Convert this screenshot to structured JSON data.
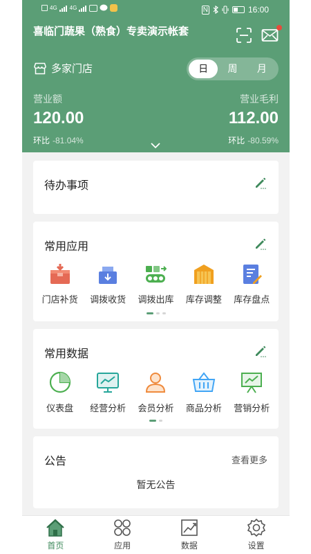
{
  "status_bar": {
    "time": "16:00",
    "left_tags": [
      "HD",
      "4G",
      "4G"
    ]
  },
  "header": {
    "store_title": "喜临门蔬果（熟食）专卖演示帐套",
    "store_selector": "多家门店",
    "periods": [
      "日",
      "周",
      "月"
    ],
    "active_period": "日",
    "metrics": [
      {
        "label": "营业额",
        "value": "120.00",
        "compare_label": "环比",
        "compare_value": "-81.04%"
      },
      {
        "label": "营业毛利",
        "value": "112.00",
        "compare_label": "环比",
        "compare_value": "-80.59%"
      }
    ]
  },
  "todo": {
    "title": "待办事项"
  },
  "common_apps": {
    "title": "常用应用",
    "items": [
      {
        "label": "门店补货",
        "icon": "restock-box-icon"
      },
      {
        "label": "调拨收货",
        "icon": "transfer-receive-icon"
      },
      {
        "label": "调拨出库",
        "icon": "transfer-out-icon"
      },
      {
        "label": "库存调整",
        "icon": "inventory-adjust-icon"
      },
      {
        "label": "库存盘点",
        "icon": "inventory-count-icon"
      }
    ]
  },
  "common_data": {
    "title": "常用数据",
    "items": [
      {
        "label": "仪表盘",
        "icon": "pie-chart-icon"
      },
      {
        "label": "经营分析",
        "icon": "line-chart-icon"
      },
      {
        "label": "会员分析",
        "icon": "member-icon"
      },
      {
        "label": "商品分析",
        "icon": "basket-icon"
      },
      {
        "label": "营销分析",
        "icon": "presentation-icon"
      }
    ]
  },
  "notice": {
    "title": "公告",
    "more": "查看更多",
    "empty": "暂无公告"
  },
  "tabbar": {
    "items": [
      {
        "label": "首页",
        "icon": "home-icon"
      },
      {
        "label": "应用",
        "icon": "apps-icon"
      },
      {
        "label": "数据",
        "icon": "data-chart-icon"
      },
      {
        "label": "设置",
        "icon": "settings-icon"
      }
    ],
    "active": "首页"
  },
  "colors": {
    "brand": "#5b9e76",
    "active_tab": "#3f8a5c",
    "badge": "#e64b3c"
  }
}
